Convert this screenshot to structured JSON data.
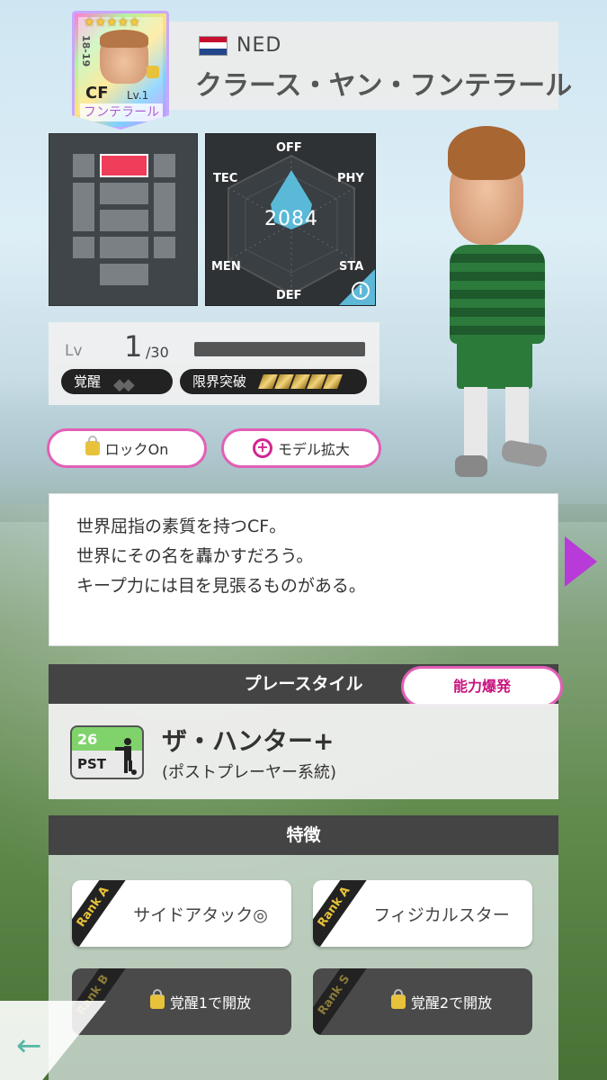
{
  "player": {
    "nation": "NED",
    "name": "クラース・ヤン・フンテラール",
    "card_stars": "★★★★★",
    "season": "18-19",
    "position": "CF",
    "card_level": "Lv.1",
    "card_name": "フンテラール",
    "total": "2084"
  },
  "radar": {
    "labels": {
      "off": "OFF",
      "tec": "TEC",
      "phy": "PHY",
      "men": "MEN",
      "sta": "STA",
      "def": "DEF"
    }
  },
  "level": {
    "label": "Lv",
    "current": "1",
    "max": "/30",
    "awakening_label": "覚醒",
    "limit_break_label": "限界突破"
  },
  "buttons": {
    "lock": "ロックOn",
    "zoom": "モデル拡大"
  },
  "description": {
    "line1": "世界屈指の素質を持つCF。",
    "line2": "世界にその名を轟かすだろう。",
    "line3": "キープ力には目を見張るものがある。"
  },
  "playstyle": {
    "header": "プレースタイル",
    "ability_button": "能力爆発",
    "number": "26",
    "code": "PST",
    "title": "ザ・ハンター+",
    "subtitle": "(ポストプレーヤー系統)"
  },
  "traits": {
    "header": "特徴",
    "items": [
      {
        "rank": "Rank A",
        "label": "サイドアタック◎"
      },
      {
        "rank": "Rank A",
        "label": "フィジカルスター"
      },
      {
        "rank": "Rank B",
        "label": "覚醒1で開放"
      },
      {
        "rank": "Rank S",
        "label": "覚醒2で開放"
      }
    ]
  },
  "colors": {
    "accent_pink": "#e25fb6",
    "active_position": "#ef3d5a",
    "radar_fill": "#5ec6e8",
    "next_arrow": "#b83ad8"
  },
  "icons": {
    "lock": "lock-icon",
    "zoom": "zoom-plus-icon",
    "info": "info-icon",
    "back": "back-arrow-icon",
    "next": "next-arrow-icon"
  }
}
